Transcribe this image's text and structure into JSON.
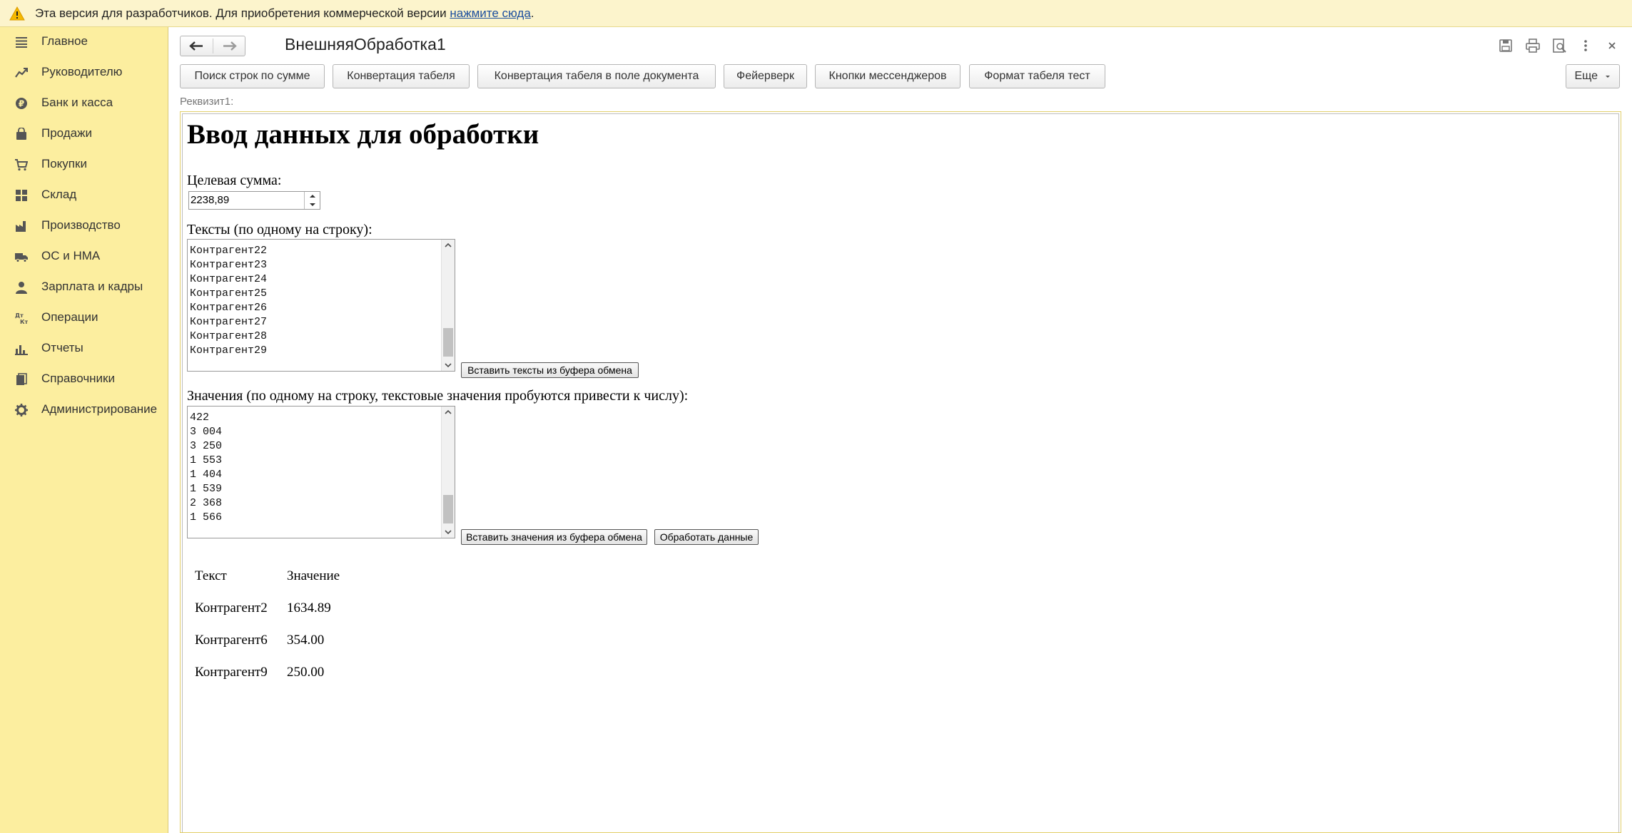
{
  "banner": {
    "icon": "warning-icon",
    "text": "Эта версия для разработчиков. Для приобретения коммерческой версии",
    "link": "нажмите сюда",
    "suffix": "."
  },
  "sidebar": {
    "items": [
      {
        "label": "Главное",
        "icon": "menu-lines-icon"
      },
      {
        "label": "Руководителю",
        "icon": "trend-chart-icon"
      },
      {
        "label": "Банк и касса",
        "icon": "ruble-coin-icon"
      },
      {
        "label": "Продажи",
        "icon": "shopping-bag-icon"
      },
      {
        "label": "Покупки",
        "icon": "cart-icon"
      },
      {
        "label": "Склад",
        "icon": "warehouse-grid-icon"
      },
      {
        "label": "Производство",
        "icon": "factory-icon"
      },
      {
        "label": "ОС и НМА",
        "icon": "truck-icon"
      },
      {
        "label": "Зарплата и кадры",
        "icon": "person-icon"
      },
      {
        "label": "Операции",
        "icon": "debit-credit-icon"
      },
      {
        "label": "Отчеты",
        "icon": "bar-chart-icon"
      },
      {
        "label": "Справочники",
        "icon": "books-icon"
      },
      {
        "label": "Администрирование",
        "icon": "gear-icon"
      }
    ]
  },
  "header": {
    "title": "ВнешняяОбработка1",
    "icons": [
      "save-icon",
      "print-icon",
      "preview-icon",
      "more-vertical-icon",
      "close-icon"
    ]
  },
  "toolbar": {
    "buttons": [
      "Поиск строк по сумме",
      "Конвертация табеля",
      "Конвертация табеля в поле документа",
      "Фейерверк",
      "Кнопки мессенджеров",
      "Формат табеля тест"
    ],
    "more": "Еще"
  },
  "form": {
    "requisite_label": "Реквизит1:",
    "heading": "Ввод данных для обработки",
    "target_sum_label": "Целевая сумма:",
    "target_sum_value": "2238,89",
    "texts_label": "Тексты (по одному на строку):",
    "texts_lines": [
      "Контрагент22",
      "Контрагент23",
      "Контрагент24",
      "Контрагент25",
      "Контрагент26",
      "Контрагент27",
      "Контрагент28",
      "Контрагент29"
    ],
    "paste_texts_button": "Вставить тексты из буфера обмена",
    "values_label": "Значения (по одному на строку, текстовые значения пробуются привести к числу):",
    "values_lines": [
      "422",
      "3 004",
      "3 250",
      "1 553",
      "1 404",
      "1 539",
      "2 368",
      "1 566"
    ],
    "paste_values_button": "Вставить значения из буфера обмена",
    "process_button": "Обработать данные"
  },
  "results": {
    "headers": [
      "Текст",
      "Значение"
    ],
    "rows": [
      [
        "Контрагент2",
        "1634.89"
      ],
      [
        "Контрагент6",
        "354.00"
      ],
      [
        "Контрагент9",
        "250.00"
      ]
    ]
  }
}
